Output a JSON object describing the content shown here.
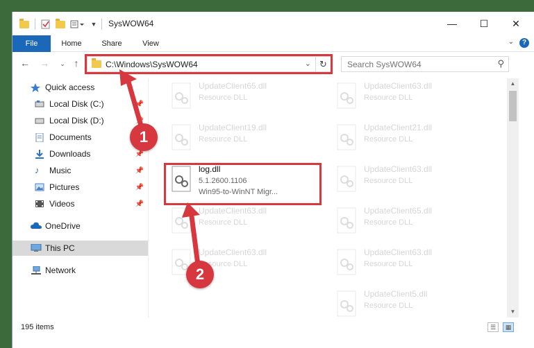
{
  "window": {
    "title": "SysWOW64",
    "minimize_label": "—",
    "maximize_label": "☐",
    "close_label": "✕"
  },
  "ribbon": {
    "tabs": [
      "File",
      "Home",
      "Share",
      "View"
    ],
    "help": "?"
  },
  "navigation": {
    "address": "C:\\Windows\\SysWOW64",
    "search_placeholder": "Search SysWOW64"
  },
  "sidebar": {
    "items": [
      {
        "label": "Quick access",
        "icon": "star-icon",
        "pinned": false
      },
      {
        "label": "Local Disk (C:)",
        "icon": "drive-icon",
        "pinned": true
      },
      {
        "label": "Local Disk (D:)",
        "icon": "drive-icon",
        "pinned": true
      },
      {
        "label": "Documents",
        "icon": "documents-icon",
        "pinned": true
      },
      {
        "label": "Downloads",
        "icon": "download-icon",
        "pinned": true
      },
      {
        "label": "Music",
        "icon": "music-icon",
        "pinned": true
      },
      {
        "label": "Pictures",
        "icon": "pictures-icon",
        "pinned": true
      },
      {
        "label": "Videos",
        "icon": "videos-icon",
        "pinned": true
      },
      {
        "label": "OneDrive",
        "icon": "cloud-icon",
        "pinned": false
      },
      {
        "label": "This PC",
        "icon": "computer-icon",
        "pinned": false,
        "selected": true
      },
      {
        "label": "Network",
        "icon": "network-icon",
        "pinned": false
      }
    ]
  },
  "files": [
    {
      "name": "UpdateClient65.dll",
      "type": "Resource DLL",
      "highlighted": false
    },
    {
      "name": "UpdateClient63.dll",
      "type": "Resource DLL",
      "highlighted": false
    },
    {
      "name": "UpdateClient19.dll",
      "type": "Resource DLL",
      "highlighted": false
    },
    {
      "name": "UpdateClient21.dll",
      "type": "Resource DLL",
      "highlighted": false
    },
    {
      "name": "log.dll",
      "type": "5.1.2600.1106",
      "extra": "Win95-to-WinNT Migr...",
      "highlighted": true
    },
    {
      "name": "UpdateClient63.dll",
      "type": "Resource DLL",
      "highlighted": false
    },
    {
      "name": "UpdateClient63.dll",
      "type": "Resource DLL",
      "highlighted": false
    },
    {
      "name": "UpdateClient65.dll",
      "type": "Resource DLL",
      "highlighted": false
    },
    {
      "name": "UpdateClient63.dll",
      "type": "Resource DLL",
      "highlighted": false
    },
    {
      "name": "UpdateClient63.dll",
      "type": "Resource DLL",
      "highlighted": false
    },
    {
      "name": "UpdateClient5.dll",
      "type": "Resource DLL",
      "highlighted": false
    }
  ],
  "status": {
    "item_count": "195 items"
  },
  "callouts": [
    "1",
    "2"
  ],
  "colors": {
    "accent": "#1c68b8",
    "callout_red": "#d7373f",
    "selection": "#d9d9d9"
  }
}
